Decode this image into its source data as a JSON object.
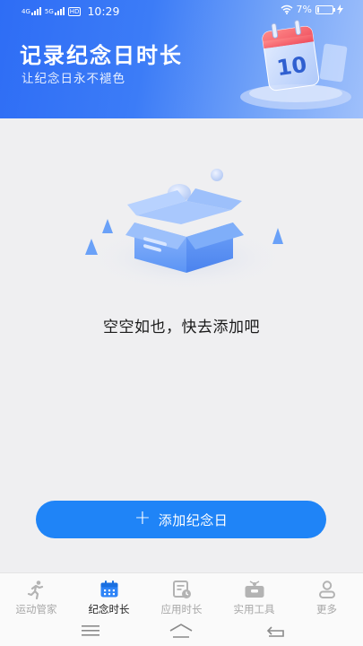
{
  "status_bar": {
    "network_top": "4G",
    "network_bottom": "5G",
    "hd_badge": "HD",
    "time": "10:29",
    "battery_percent": "7%",
    "battery_level": 0.07
  },
  "header": {
    "title": "记录纪念日时长",
    "subtitle": "让纪念日永不褪色",
    "calendar_day": "10"
  },
  "empty_state": {
    "text": "空空如也，快去添加吧"
  },
  "add_button": {
    "icon": "plus-icon",
    "label": "添加纪念日"
  },
  "tabs": [
    {
      "label": "运动管家",
      "icon": "running-icon",
      "active": false
    },
    {
      "label": "纪念时长",
      "icon": "calendar-icon",
      "active": true
    },
    {
      "label": "应用时长",
      "icon": "app-clock-icon",
      "active": false
    },
    {
      "label": "实用工具",
      "icon": "toolbox-icon",
      "active": false
    },
    {
      "label": "更多",
      "icon": "person-icon",
      "active": false
    }
  ],
  "colors": {
    "primary": "#1f84f7",
    "header_start": "#2e6df5",
    "header_end": "#9fc0fb",
    "background": "#efeff1",
    "tab_active": "#222222",
    "tab_inactive": "#a7a7a7"
  }
}
